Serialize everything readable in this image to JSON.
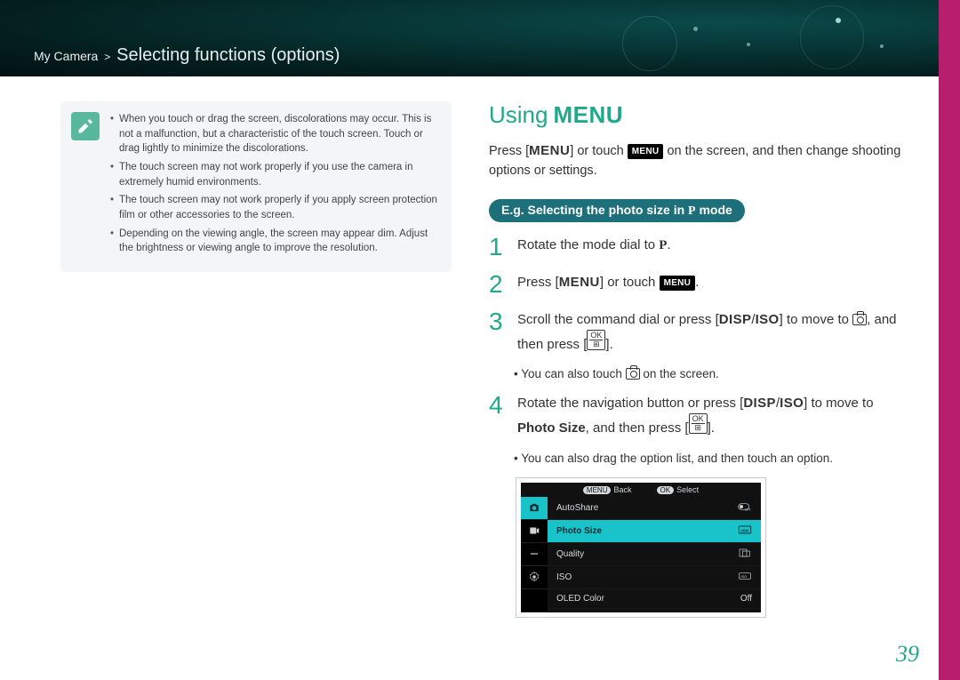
{
  "breadcrumb": {
    "section": "My Camera",
    "page": "Selecting functions (options)"
  },
  "notes": [
    "When you touch or drag the screen, discolorations may occur. This is not a malfunction, but a characteristic of the touch screen. Touch or drag lightly to minimize the discolorations.",
    "The touch screen may not work properly if you use the camera in extremely humid environments.",
    "The touch screen may not work properly if you apply screen protection film or other accessories to the screen.",
    "Depending on the viewing angle, the screen may appear dim. Adjust the brightness or viewing angle to improve the resolution."
  ],
  "heading": {
    "prefix": "Using",
    "label": "MENU"
  },
  "intro": {
    "a": "Press [",
    "b": "] or touch ",
    "c": " on the screen, and then change shooting options or settings."
  },
  "pill": {
    "a": "E.g. Selecting the photo size in ",
    "p": "P",
    "b": " mode"
  },
  "steps": {
    "s1": {
      "a": "Rotate the mode dial to ",
      "p": "P",
      "b": "."
    },
    "s2": {
      "a": "Press [",
      "b": "] or touch ",
      "c": "."
    },
    "s3": {
      "a": "Scroll the command dial or press [",
      "disp": "DISP",
      "slash": "/",
      "iso": "ISO",
      "b": "] to move to ",
      "c": ", and then press [",
      "d": "]."
    },
    "s3note": {
      "a": "You can also touch ",
      "b": " on the screen."
    },
    "s4": {
      "a": "Rotate the navigation button or press [",
      "disp": "DISP",
      "slash": "/",
      "iso": "ISO",
      "b": "] to move to ",
      "bold": "Photo Size",
      "c": ", and then press [",
      "d": "]."
    },
    "s4note": "You can also drag the option list, and then touch an option."
  },
  "sshot": {
    "back": "Back",
    "select": "Select",
    "menu_btn": "MENU",
    "ok_btn": "OK",
    "rows": [
      {
        "label": "AutoShare",
        "value_icon": "toggle-off"
      },
      {
        "label": "Photo Size",
        "value_icon": "size-20m",
        "selected": true
      },
      {
        "label": "Quality",
        "value_icon": "quality"
      },
      {
        "label": "ISO",
        "value_icon": "iso"
      },
      {
        "label": "OLED Color",
        "value": "Off"
      }
    ]
  },
  "page_number": "39"
}
